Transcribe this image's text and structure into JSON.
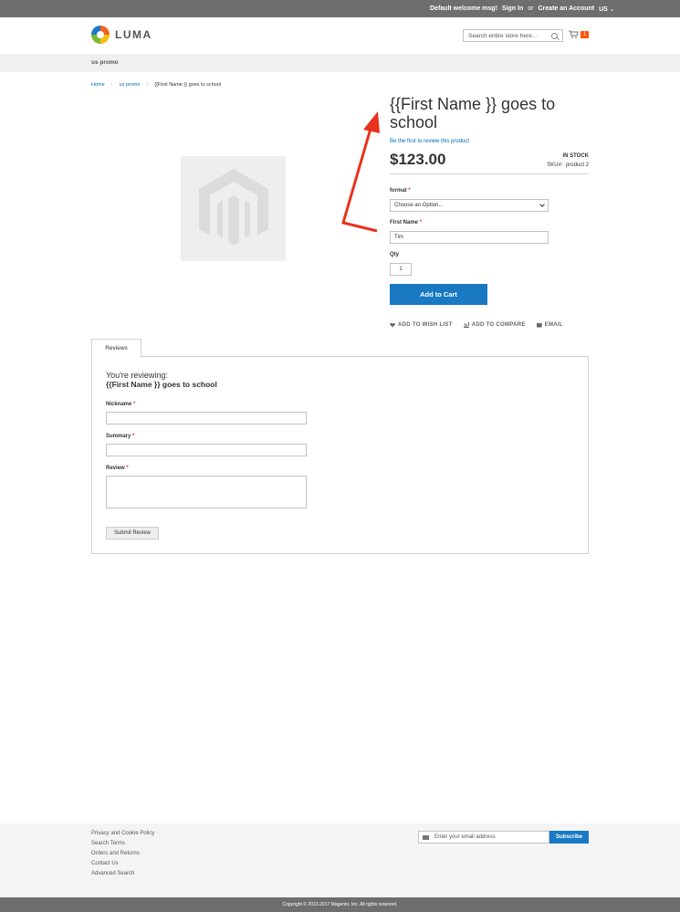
{
  "topbar": {
    "welcome": "Default welcome msg!",
    "sign_in": "Sign In",
    "or": "or",
    "create_account": "Create an Account",
    "region": "US"
  },
  "header": {
    "logo_text": "LUMA",
    "search_placeholder": "Search entire store here...",
    "cart_count": "1"
  },
  "nav": {
    "item": "us promo"
  },
  "breadcrumbs": {
    "home": "Home",
    "category": "us promo",
    "current": "{{First Name }} goes to school"
  },
  "product": {
    "title": "{{First Name }} goes to school",
    "review_link": "Be the first to review this product",
    "price": "$123.00",
    "stock": "IN STOCK",
    "sku_label": "SKU#:",
    "sku_value": "product 2",
    "format_label": "format",
    "format_value": "Choose an Option...",
    "first_name_label": "First Name",
    "first_name_value": "Tim",
    "qty_label": "Qty",
    "qty_value": "1",
    "add_to_cart": "Add to Cart",
    "wish_list": "ADD TO WISH LIST",
    "compare": "ADD TO COMPARE",
    "email": "EMAIL",
    "required_mark": "*"
  },
  "reviews": {
    "tab": "Reviews",
    "reviewing": "You're reviewing:",
    "product_name": "{{First Name }} goes to school",
    "nickname_label": "Nickname",
    "summary_label": "Summary",
    "review_label": "Review",
    "submit": "Submit Review"
  },
  "footer": {
    "links": [
      "Privacy and Cookie Policy",
      "Search Terms",
      "Orders and Returns",
      "Contact Us",
      "Advanced Search"
    ],
    "newsletter_placeholder": "Enter your email address",
    "subscribe": "Subscribe",
    "copyright": "Copyright © 2013-2017 Magento, Inc. All rights reserved."
  },
  "colors": {
    "accent": "#1979c3",
    "annotation_arrow": "#e8321d",
    "cart_badge": "#ff5501"
  }
}
